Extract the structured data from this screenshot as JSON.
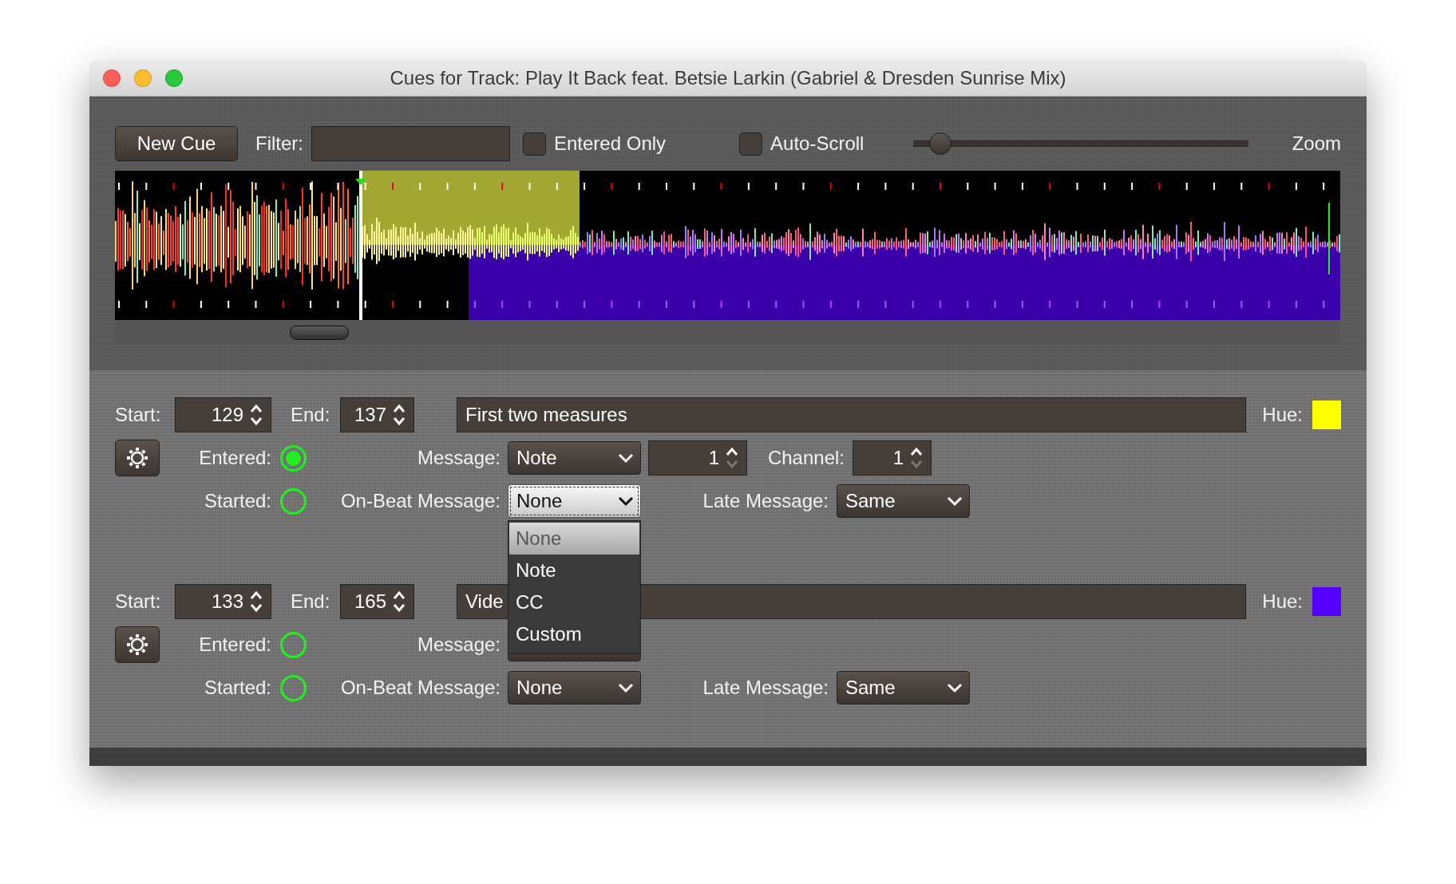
{
  "window": {
    "title": "Cues for Track: Play It Back feat. Betsie Larkin (Gabriel & Dresden Sunrise Mix)"
  },
  "toolbar": {
    "new_cue": "New Cue",
    "filter_label": "Filter:",
    "entered_only": {
      "label": "Entered Only",
      "checked": false
    },
    "auto_scroll": {
      "label": "Auto-Scroll",
      "checked": false
    },
    "zoom": {
      "label": "Zoom",
      "level": 0.08
    }
  },
  "cues": [
    {
      "start_label": "Start:",
      "start": "129",
      "end_label": "End:",
      "end": "137",
      "comment": "First two measures",
      "hue_label": "Hue:",
      "color": "#ffff00",
      "entered_label": "Entered:",
      "entered": true,
      "message_label": "Message:",
      "message": "Note",
      "note": "1",
      "channel_label": "Channel:",
      "channel": "1",
      "started_label": "Started:",
      "started": false,
      "on_beat_label": "On-Beat Message:",
      "on_beat": "None",
      "on_beat_open": true,
      "late_label": "Late Message:",
      "late": "Same"
    },
    {
      "start_label": "Start:",
      "start": "133",
      "end_label": "End:",
      "end": "165",
      "comment": "Vide",
      "hue_label": "Hue:",
      "color": "#5500ff",
      "entered_label": "Entered:",
      "entered": false,
      "message_label": "Message:",
      "started_label": "Started:",
      "started": false,
      "on_beat_label": "On-Beat Message:",
      "on_beat": "None",
      "on_beat_open": false,
      "late_label": "Late Message:",
      "late": "Same"
    }
  ],
  "dropdown": {
    "options": [
      {
        "label": "None",
        "selected": true
      },
      {
        "label": "Note",
        "selected": false
      },
      {
        "label": "CC",
        "selected": false
      },
      {
        "label": "Custom",
        "selected": false
      }
    ]
  }
}
